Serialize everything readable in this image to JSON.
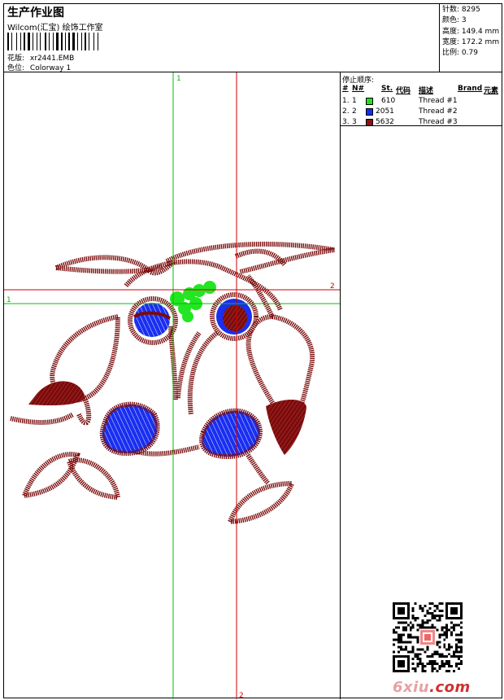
{
  "header": {
    "title": "生产作业图",
    "subtitle": "Wilcom(汇宝) 绘饰工作室",
    "design_label": "花版:",
    "design_value": "xr2441.EMB",
    "colorway_label": "色位:",
    "colorway_value": "Colorway 1"
  },
  "stats": [
    {
      "label": "针数:",
      "value": "8295"
    },
    {
      "label": "颜色:",
      "value": "3"
    },
    {
      "label": "高度:",
      "value": "149.4 mm"
    },
    {
      "label": "宽度:",
      "value": "172.2 mm"
    },
    {
      "label": "比例:",
      "value": "0.79"
    }
  ],
  "stop_sequence": {
    "title": "停止顺序:",
    "headers": {
      "num": "#",
      "n": "N#",
      "st": "St.",
      "code": "代码",
      "desc": "描述",
      "brand": "Brand",
      "element": "元素"
    },
    "rows": [
      {
        "num": "1.",
        "n": "1",
        "color": "#20e020",
        "code": "610",
        "desc": "Thread #1"
      },
      {
        "num": "2.",
        "n": "2",
        "color": "#1030f0",
        "code": "2051",
        "desc": "Thread #2"
      },
      {
        "num": "3.",
        "n": "3",
        "color": "#8a1212",
        "code": "5632",
        "desc": "Thread #3"
      }
    ]
  },
  "guides": {
    "v1_label": "1",
    "v2_label": "2",
    "h1_label": "1",
    "h2_label": "2",
    "green": "#00c000",
    "red": "#d00000"
  },
  "colors": {
    "maroon": "#7a0c0c",
    "blue": "#1a2ff0",
    "green": "#22e622"
  },
  "watermark": {
    "site": "6xiu",
    "tld": ".com"
  }
}
